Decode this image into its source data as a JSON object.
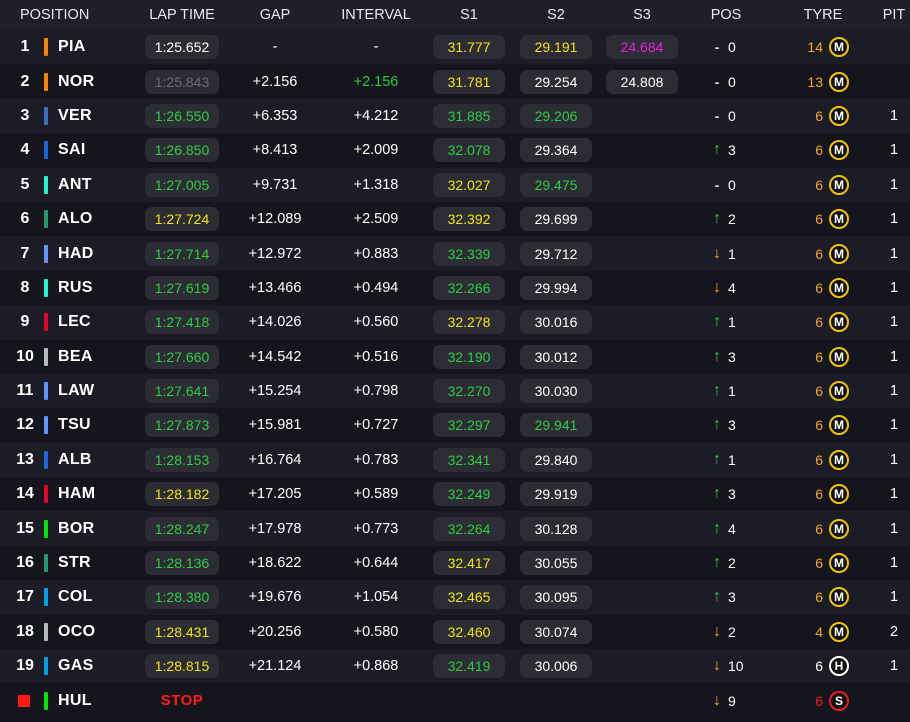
{
  "headers": {
    "position": "POSITION",
    "lap_time": "LAP TIME",
    "gap": "GAP",
    "interval": "INTERVAL",
    "s1": "S1",
    "s2": "S2",
    "s3": "S3",
    "pos": "POS",
    "tyre": "TYRE",
    "pit": "PIT"
  },
  "colors": {
    "green": "#2ecc40",
    "yellow": "#f1e60f",
    "purple": "#e024d8",
    "white": "#ffffff",
    "dim": "#6a6a72",
    "orange": "#f5a623",
    "red": "#ff1a1a",
    "medium_tyre": "#f1c40f",
    "hard_tyre": "#ffffff",
    "soft_tyre": "#e02020"
  },
  "rows": [
    {
      "pos": "1",
      "stripe": "#ff8000",
      "code": "PIA",
      "lap": "1:25.652",
      "lap_c": "white",
      "gap": "-",
      "int": "-",
      "int_c": "white",
      "s1": "31.777",
      "s1_c": "yellow",
      "s2": "29.191",
      "s2_c": "yellow",
      "s3": "24.684",
      "s3_c": "purple",
      "dir": "none",
      "pchg": "0",
      "laps": "14",
      "laps_c": "orange",
      "tyre": "M",
      "pit": ""
    },
    {
      "pos": "2",
      "stripe": "#ff8000",
      "code": "NOR",
      "lap": "1:25.843",
      "lap_c": "dim",
      "gap": "+2.156",
      "int": "+2.156",
      "int_c": "green",
      "s1": "31.781",
      "s1_c": "yellow",
      "s2": "29.254",
      "s2_c": "white",
      "s3": "24.808",
      "s3_c": "white",
      "dir": "none",
      "pchg": "0",
      "laps": "13",
      "laps_c": "orange",
      "tyre": "M",
      "pit": ""
    },
    {
      "pos": "3",
      "stripe": "#3671c6",
      "code": "VER",
      "lap": "1:26.550",
      "lap_c": "green",
      "gap": "+6.353",
      "int": "+4.212",
      "int_c": "white",
      "s1": "31.885",
      "s1_c": "green",
      "s2": "29.206",
      "s2_c": "green",
      "s3": "",
      "s3_c": "white",
      "dir": "none",
      "pchg": "0",
      "laps": "6",
      "laps_c": "orange",
      "tyre": "M",
      "pit": "1"
    },
    {
      "pos": "4",
      "stripe": "#1868db",
      "code": "SAI",
      "lap": "1:26.850",
      "lap_c": "green",
      "gap": "+8.413",
      "int": "+2.009",
      "int_c": "white",
      "s1": "32.078",
      "s1_c": "green",
      "s2": "29.364",
      "s2_c": "white",
      "s3": "",
      "s3_c": "white",
      "dir": "up",
      "pchg": "3",
      "laps": "6",
      "laps_c": "orange",
      "tyre": "M",
      "pit": "1"
    },
    {
      "pos": "5",
      "stripe": "#27f4d2",
      "code": "ANT",
      "lap": "1:27.005",
      "lap_c": "green",
      "gap": "+9.731",
      "int": "+1.318",
      "int_c": "white",
      "s1": "32.027",
      "s1_c": "yellow",
      "s2": "29.475",
      "s2_c": "green",
      "s3": "",
      "s3_c": "white",
      "dir": "none",
      "pchg": "0",
      "laps": "6",
      "laps_c": "orange",
      "tyre": "M",
      "pit": "1"
    },
    {
      "pos": "6",
      "stripe": "#229971",
      "code": "ALO",
      "lap": "1:27.724",
      "lap_c": "yellow",
      "gap": "+12.089",
      "int": "+2.509",
      "int_c": "white",
      "s1": "32.392",
      "s1_c": "yellow",
      "s2": "29.699",
      "s2_c": "white",
      "s3": "",
      "s3_c": "white",
      "dir": "up",
      "pchg": "2",
      "laps": "6",
      "laps_c": "orange",
      "tyre": "M",
      "pit": "1"
    },
    {
      "pos": "7",
      "stripe": "#6692ff",
      "code": "HAD",
      "lap": "1:27.714",
      "lap_c": "green",
      "gap": "+12.972",
      "int": "+0.883",
      "int_c": "white",
      "s1": "32.339",
      "s1_c": "green",
      "s2": "29.712",
      "s2_c": "white",
      "s3": "",
      "s3_c": "white",
      "dir": "down",
      "pchg": "1",
      "laps": "6",
      "laps_c": "orange",
      "tyre": "M",
      "pit": "1"
    },
    {
      "pos": "8",
      "stripe": "#27f4d2",
      "code": "RUS",
      "lap": "1:27.619",
      "lap_c": "green",
      "gap": "+13.466",
      "int": "+0.494",
      "int_c": "white",
      "s1": "32.266",
      "s1_c": "green",
      "s2": "29.994",
      "s2_c": "white",
      "s3": "",
      "s3_c": "white",
      "dir": "down",
      "pchg": "4",
      "laps": "6",
      "laps_c": "orange",
      "tyre": "M",
      "pit": "1"
    },
    {
      "pos": "9",
      "stripe": "#e8002d",
      "code": "LEC",
      "lap": "1:27.418",
      "lap_c": "green",
      "gap": "+14.026",
      "int": "+0.560",
      "int_c": "white",
      "s1": "32.278",
      "s1_c": "yellow",
      "s2": "30.016",
      "s2_c": "white",
      "s3": "",
      "s3_c": "white",
      "dir": "up",
      "pchg": "1",
      "laps": "6",
      "laps_c": "orange",
      "tyre": "M",
      "pit": "1"
    },
    {
      "pos": "10",
      "stripe": "#b6babd",
      "code": "BEA",
      "lap": "1:27.660",
      "lap_c": "green",
      "gap": "+14.542",
      "int": "+0.516",
      "int_c": "white",
      "s1": "32.190",
      "s1_c": "green",
      "s2": "30.012",
      "s2_c": "white",
      "s3": "",
      "s3_c": "white",
      "dir": "up",
      "pchg": "3",
      "laps": "6",
      "laps_c": "orange",
      "tyre": "M",
      "pit": "1"
    },
    {
      "pos": "11",
      "stripe": "#6692ff",
      "code": "LAW",
      "lap": "1:27.641",
      "lap_c": "green",
      "gap": "+15.254",
      "int": "+0.798",
      "int_c": "white",
      "s1": "32.270",
      "s1_c": "green",
      "s2": "30.030",
      "s2_c": "white",
      "s3": "",
      "s3_c": "white",
      "dir": "up",
      "pchg": "1",
      "laps": "6",
      "laps_c": "orange",
      "tyre": "M",
      "pit": "1"
    },
    {
      "pos": "12",
      "stripe": "#6692ff",
      "code": "TSU",
      "lap": "1:27.873",
      "lap_c": "green",
      "gap": "+15.981",
      "int": "+0.727",
      "int_c": "white",
      "s1": "32.297",
      "s1_c": "green",
      "s2": "29.941",
      "s2_c": "green",
      "s3": "",
      "s3_c": "white",
      "dir": "up",
      "pchg": "3",
      "laps": "6",
      "laps_c": "orange",
      "tyre": "M",
      "pit": "1"
    },
    {
      "pos": "13",
      "stripe": "#1868db",
      "code": "ALB",
      "lap": "1:28.153",
      "lap_c": "green",
      "gap": "+16.764",
      "int": "+0.783",
      "int_c": "white",
      "s1": "32.341",
      "s1_c": "green",
      "s2": "29.840",
      "s2_c": "white",
      "s3": "",
      "s3_c": "white",
      "dir": "up",
      "pchg": "1",
      "laps": "6",
      "laps_c": "orange",
      "tyre": "M",
      "pit": "1"
    },
    {
      "pos": "14",
      "stripe": "#e8002d",
      "code": "HAM",
      "lap": "1:28.182",
      "lap_c": "yellow",
      "gap": "+17.205",
      "int": "+0.589",
      "int_c": "white",
      "s1": "32.249",
      "s1_c": "green",
      "s2": "29.919",
      "s2_c": "white",
      "s3": "",
      "s3_c": "white",
      "dir": "up",
      "pchg": "3",
      "laps": "6",
      "laps_c": "orange",
      "tyre": "M",
      "pit": "1"
    },
    {
      "pos": "15",
      "stripe": "#00e700",
      "code": "BOR",
      "lap": "1:28.247",
      "lap_c": "green",
      "gap": "+17.978",
      "int": "+0.773",
      "int_c": "white",
      "s1": "32.264",
      "s1_c": "green",
      "s2": "30.128",
      "s2_c": "white",
      "s3": "",
      "s3_c": "white",
      "dir": "up",
      "pchg": "4",
      "laps": "6",
      "laps_c": "orange",
      "tyre": "M",
      "pit": "1"
    },
    {
      "pos": "16",
      "stripe": "#229971",
      "code": "STR",
      "lap": "1:28.136",
      "lap_c": "green",
      "gap": "+18.622",
      "int": "+0.644",
      "int_c": "white",
      "s1": "32.417",
      "s1_c": "yellow",
      "s2": "30.055",
      "s2_c": "white",
      "s3": "",
      "s3_c": "white",
      "dir": "up",
      "pchg": "2",
      "laps": "6",
      "laps_c": "orange",
      "tyre": "M",
      "pit": "1"
    },
    {
      "pos": "17",
      "stripe": "#00a1e8",
      "code": "COL",
      "lap": "1:28.380",
      "lap_c": "green",
      "gap": "+19.676",
      "int": "+1.054",
      "int_c": "white",
      "s1": "32.465",
      "s1_c": "yellow",
      "s2": "30.095",
      "s2_c": "white",
      "s3": "",
      "s3_c": "white",
      "dir": "up",
      "pchg": "3",
      "laps": "6",
      "laps_c": "orange",
      "tyre": "M",
      "pit": "1"
    },
    {
      "pos": "18",
      "stripe": "#b6babd",
      "code": "OCO",
      "lap": "1:28.431",
      "lap_c": "yellow",
      "gap": "+20.256",
      "int": "+0.580",
      "int_c": "white",
      "s1": "32.460",
      "s1_c": "yellow",
      "s2": "30.074",
      "s2_c": "white",
      "s3": "",
      "s3_c": "white",
      "dir": "down",
      "pchg": "2",
      "laps": "4",
      "laps_c": "orange",
      "tyre": "M",
      "pit": "2"
    },
    {
      "pos": "19",
      "stripe": "#00a1e8",
      "code": "GAS",
      "lap": "1:28.815",
      "lap_c": "yellow",
      "gap": "+21.124",
      "int": "+0.868",
      "int_c": "white",
      "s1": "32.419",
      "s1_c": "green",
      "s2": "30.006",
      "s2_c": "white",
      "s3": "",
      "s3_c": "white",
      "dir": "down",
      "pchg": "10",
      "laps": "6",
      "laps_c": "white",
      "tyre": "H",
      "pit": "1"
    },
    {
      "pos": "",
      "stripe": "#00e700",
      "code": "HUL",
      "lap": "STOP",
      "lap_c": "red",
      "gap": "",
      "int": "",
      "int_c": "white",
      "s1": "",
      "s1_c": "white",
      "s2": "",
      "s2_c": "white",
      "s3": "",
      "s3_c": "white",
      "dir": "down",
      "pchg": "9",
      "laps": "6",
      "laps_c": "red",
      "tyre": "S",
      "pit": ""
    }
  ]
}
